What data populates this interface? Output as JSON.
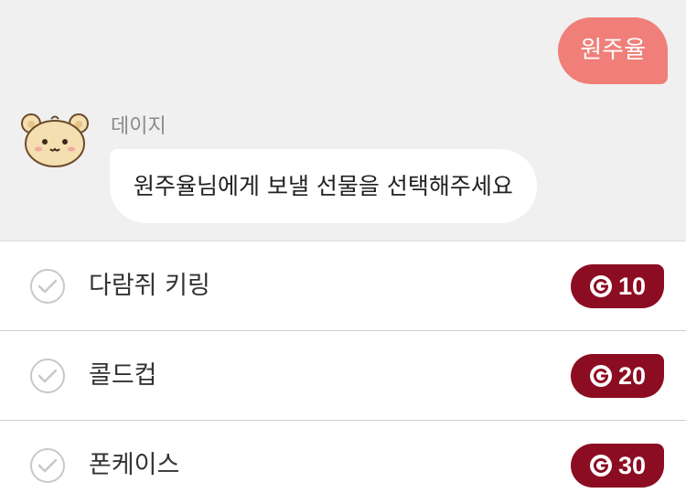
{
  "chat": {
    "user_message": "원주율",
    "sender_name": "데이지",
    "bot_message": "원주율님에게 보낼 선물을 선택해주세요"
  },
  "gifts": [
    {
      "name": "다람쥐 키링",
      "price": "10"
    },
    {
      "name": "콜드컵",
      "price": "20"
    },
    {
      "name": "폰케이스",
      "price": "30"
    }
  ],
  "icons": {
    "avatar": "bear-avatar-icon",
    "check": "checkmark-circle-icon",
    "coin": "coin-g-icon"
  },
  "colors": {
    "chat_background": "#f0f0f0",
    "user_bubble": "#f07f79",
    "price_badge": "#8c0d22"
  }
}
